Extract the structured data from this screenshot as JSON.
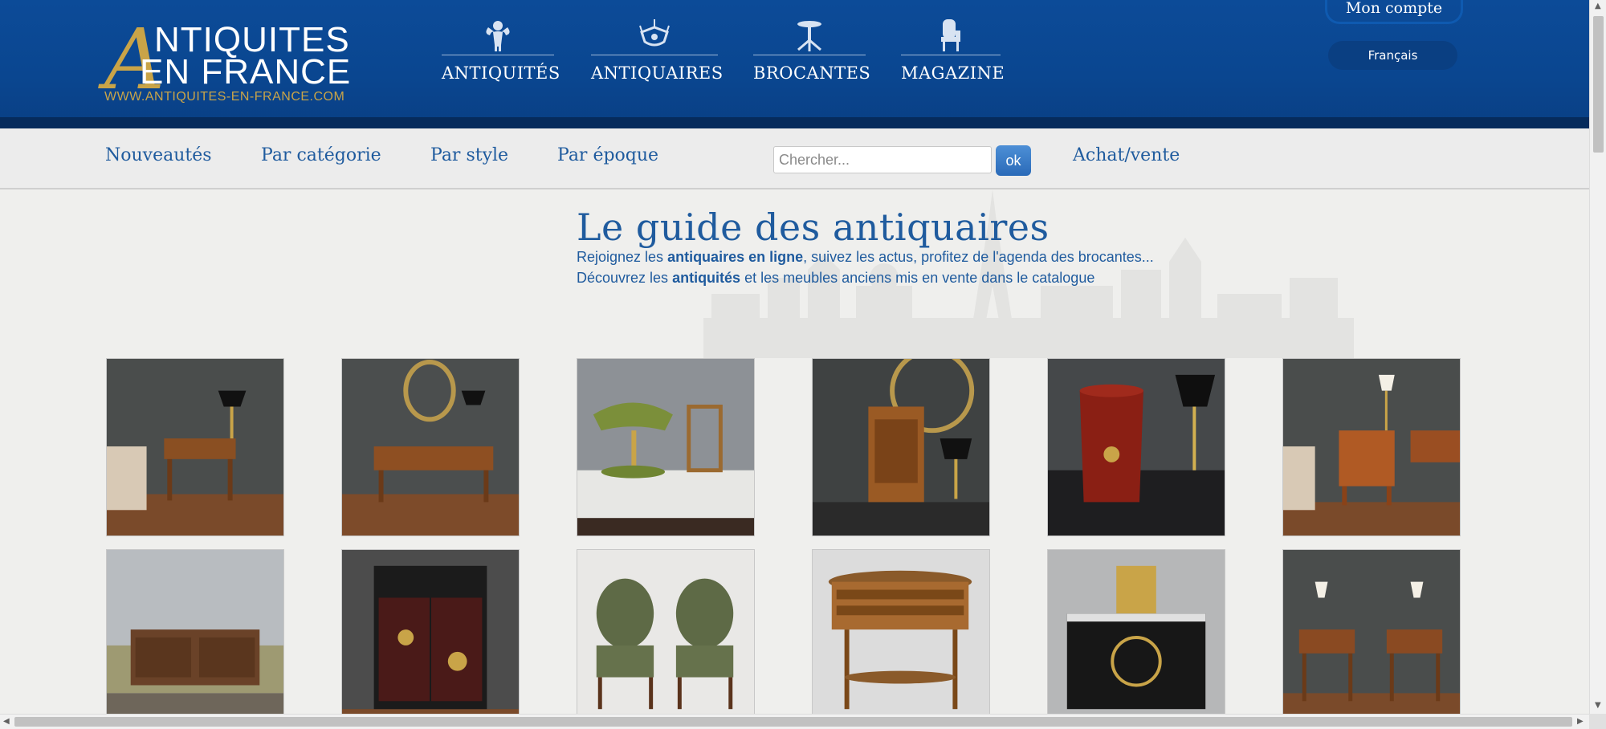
{
  "logo": {
    "letter": "A",
    "line1": "NTIQUITES",
    "line2": "EN FRANCE",
    "url": "WWW.ANTIQUITES-EN-FRANCE.COM"
  },
  "main_nav": [
    {
      "label": "ANTIQUITÉS",
      "icon": "cherub-icon"
    },
    {
      "label": "ANTIQUAIRES",
      "icon": "chandelier-icon"
    },
    {
      "label": "BROCANTES",
      "icon": "pedestal-table-icon"
    },
    {
      "label": "MAGAZINE",
      "icon": "armchair-icon"
    }
  ],
  "account": {
    "label": "Mon compte"
  },
  "language": {
    "label": "Français"
  },
  "sub_nav": {
    "links": [
      "Nouveautés",
      "Par catégorie",
      "Par style",
      "Par époque"
    ],
    "search_placeholder": "Chercher...",
    "search_button": "ok",
    "trade_link": "Achat/vente"
  },
  "hero": {
    "title": "Le guide des antiquaires",
    "line1": {
      "before": "Rejoignez les ",
      "bold": "antiquaires en ligne",
      "after": ", suivez les actus, profitez de l'agenda des brocantes..."
    },
    "line2": {
      "before": "Découvrez les ",
      "bold": "antiquités",
      "after": " et les meubles anciens mis en vente dans le catalogue"
    }
  },
  "products": [
    {
      "subject": "side-table-with-bouillotte-lamp"
    },
    {
      "subject": "writing-desk-with-mirror"
    },
    {
      "subject": "green-tole-lamp-and-rush-chair"
    },
    {
      "subject": "small-wall-cabinet-with-lamp"
    },
    {
      "subject": "red-leather-wastebasket"
    },
    {
      "subject": "nightstand-with-lamp"
    },
    {
      "subject": "country-sideboard"
    },
    {
      "subject": "lacquered-chinoiserie-cabinet"
    },
    {
      "subject": "pair-of-green-armchairs"
    },
    {
      "subject": "marquetry-kidney-table"
    },
    {
      "subject": "boulle-commode-with-clock"
    },
    {
      "subject": "pair-of-bedside-tables"
    }
  ],
  "colors": {
    "header_blue": "#0b4a96",
    "link_blue": "#1f5b9e",
    "logo_gold": "#c9a448"
  }
}
